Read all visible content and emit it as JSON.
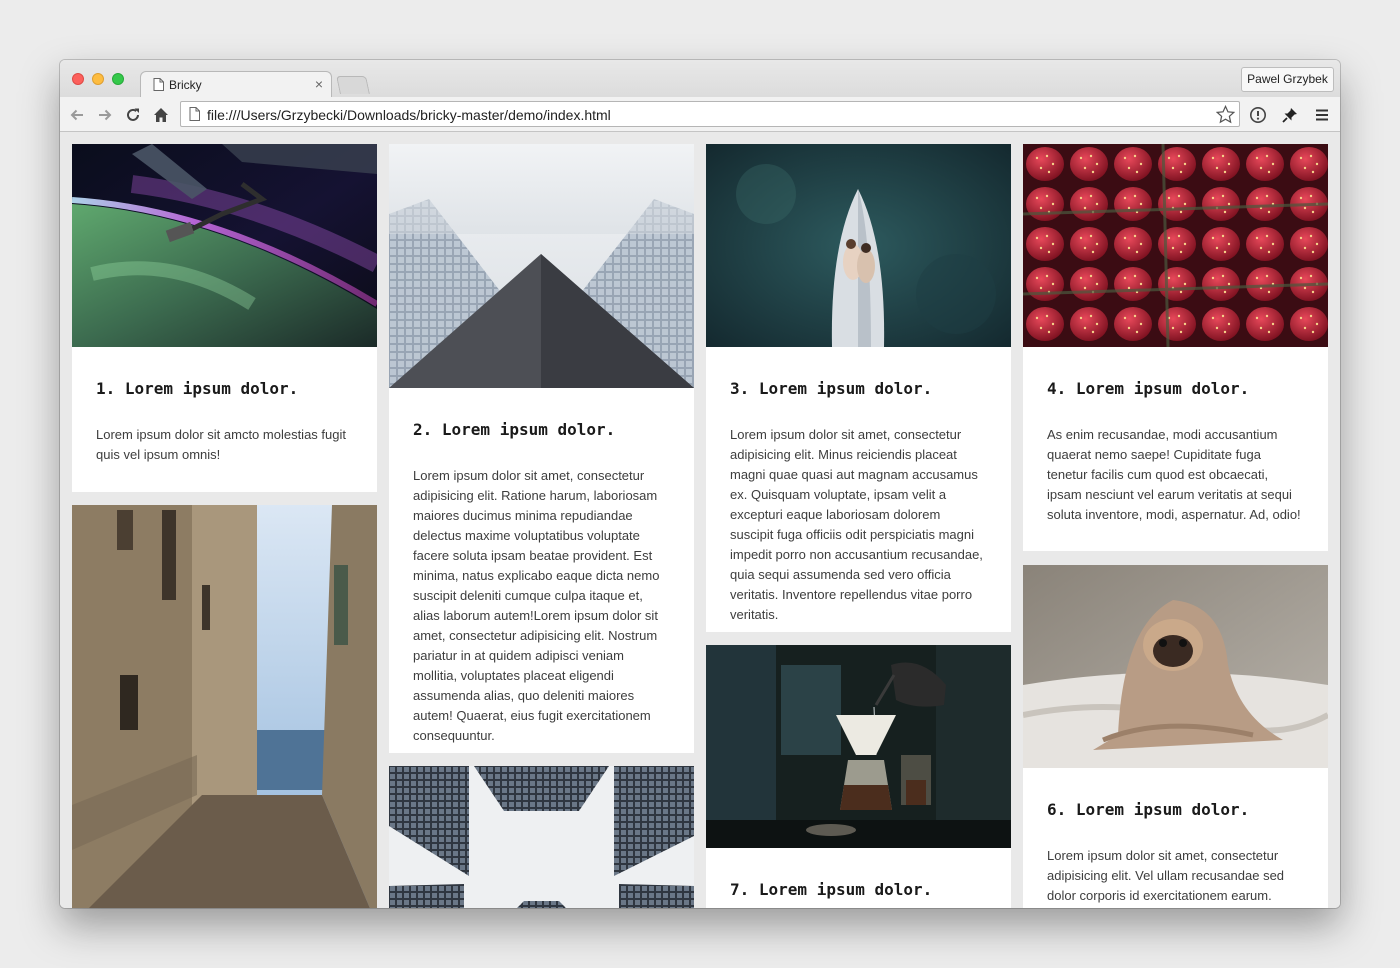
{
  "browser": {
    "tab_title": "Bricky",
    "tab_close": "×",
    "profile_name": "Pawel Grzybek",
    "url": "file:///Users/Grzybecki/Downloads/bricky-master/demo/index.html",
    "icons": [
      "back-icon",
      "forward-icon",
      "reload-icon",
      "home-icon",
      "star-icon",
      "info-icon",
      "pin-icon",
      "menu-icon"
    ]
  },
  "cards": [
    {
      "title": "1. Lorem ipsum dolor.",
      "text": "Lorem ipsum dolor sit amcto molestias fugit quis vel ipsum omnis!",
      "image": "aurora-space-station"
    },
    {
      "title": "2. Lorem ipsum dolor.",
      "text": "Lorem ipsum dolor sit amet, consectetur adipisicing elit. Ratione harum, laboriosam maiores ducimus minima repudiandae delectus maxime voluptatibus voluptate facere soluta ipsam beatae provident. Est minima, natus explicabo eaque dicta nemo suscipit deleniti cumque culpa itaque et, alias laborum autem!Lorem ipsum dolor sit amet, consectetur adipisicing elit. Nostrum pariatur in at quidem adipisci veniam mollitia, voluptates placeat eligendi assumenda alias, quo deleniti maiores autem! Quaerat, eius fugit exercitationem consequuntur.",
      "image": "skyscrapers-looking-up"
    },
    {
      "title": "3. Lorem ipsum dolor.",
      "text": "Lorem ipsum dolor sit amet, consectetur adipisicing elit. Minus reiciendis placeat magni quae quasi aut magnam accusamus ex. Quisquam voluptate, ipsam velit a excepturi eaque laboriosam dolorem suscipit fuga officiis odit perspiciatis magni impedit porro non accusantium recusandae, quia sequi assumenda sed vero officia veritatis. Inventore repellendus vitae porro veritatis.",
      "image": "couple-on-boat"
    },
    {
      "title": "4. Lorem ipsum dolor.",
      "text": "As enim recusandae, modi accusantium quaerat nemo saepe! Cupiditate fuga tenetur facilis cum quod est obcaecati, ipsam nesciunt vel earum veritatis at sequi soluta inventore, modi, aspernatur. Ad, odio!",
      "image": "strawberries"
    },
    {
      "title": "",
      "text": "",
      "image": "narrow-street-sea"
    },
    {
      "title": "",
      "text": "",
      "image": "towers-from-below"
    },
    {
      "title": "7. Lorem ipsum dolor.",
      "text": "",
      "image": "coffee-pour-over"
    },
    {
      "title": "6. Lorem ipsum dolor.",
      "text": "Lorem ipsum dolor sit amet, consectetur adipisicing elit. Vel ullam recusandae sed dolor corporis id exercitationem earum.",
      "image": "pug-in-blanket"
    }
  ]
}
